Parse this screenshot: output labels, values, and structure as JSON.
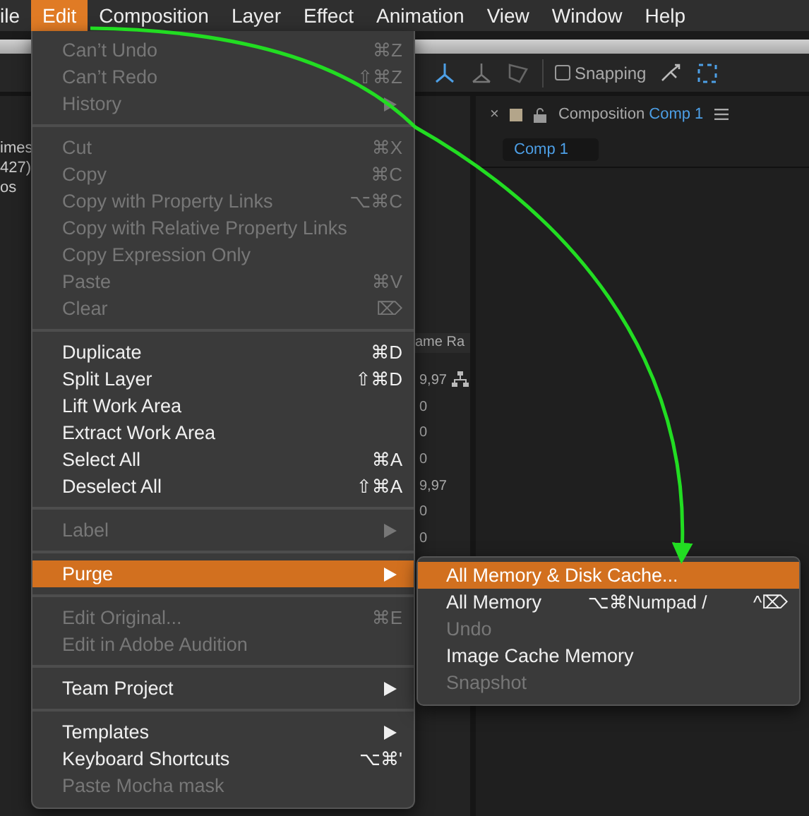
{
  "menubar": [
    {
      "label": "ile",
      "selected": false
    },
    {
      "label": "Edit",
      "selected": true
    },
    {
      "label": "Composition",
      "selected": false
    },
    {
      "label": "Layer",
      "selected": false
    },
    {
      "label": "Effect",
      "selected": false
    },
    {
      "label": "Animation",
      "selected": false
    },
    {
      "label": "View",
      "selected": false
    },
    {
      "label": "Window",
      "selected": false
    },
    {
      "label": "Help",
      "selected": false
    }
  ],
  "toolbar": {
    "snapping": {
      "label": "Snapping",
      "checked": false
    }
  },
  "left_panel": {
    "fragments": [
      "imes",
      "427)",
      "os"
    ],
    "column_header": "ame Ra",
    "cells": [
      "9,97",
      "0",
      "0",
      "0",
      "9,97",
      "0",
      "0"
    ]
  },
  "composition_panel": {
    "close": "×",
    "title": "Composition",
    "comp_name": "Comp 1",
    "tab": "Comp 1"
  },
  "edit_menu": [
    {
      "kind": "item",
      "label": "Can’t Undo",
      "shortcut": "⌘Z",
      "disabled": true,
      "submenu": false,
      "selected": false
    },
    {
      "kind": "item",
      "label": "Can’t Redo",
      "shortcut": "⇧⌘Z",
      "disabled": true,
      "submenu": false,
      "selected": false
    },
    {
      "kind": "item",
      "label": "History",
      "disabled": true,
      "submenu": true,
      "selected": false
    },
    {
      "kind": "separator"
    },
    {
      "kind": "item",
      "label": "Cut",
      "shortcut": "⌘X",
      "disabled": true,
      "submenu": false,
      "selected": false
    },
    {
      "kind": "item",
      "label": "Copy",
      "shortcut": "⌘C",
      "disabled": true,
      "submenu": false,
      "selected": false
    },
    {
      "kind": "item",
      "label": "Copy with Property Links",
      "shortcut": "⌥⌘C",
      "disabled": true,
      "submenu": false,
      "selected": false
    },
    {
      "kind": "item",
      "label": "Copy with Relative Property Links",
      "disabled": true,
      "submenu": false,
      "selected": false
    },
    {
      "kind": "item",
      "label": "Copy Expression Only",
      "disabled": true,
      "submenu": false,
      "selected": false
    },
    {
      "kind": "item",
      "label": "Paste",
      "shortcut": "⌘V",
      "disabled": true,
      "submenu": false,
      "selected": false
    },
    {
      "kind": "item",
      "label": "Clear",
      "shortcut": "⌦",
      "disabled": true,
      "submenu": false,
      "selected": false
    },
    {
      "kind": "separator"
    },
    {
      "kind": "item",
      "label": "Duplicate",
      "shortcut": "⌘D",
      "disabled": false,
      "submenu": false,
      "selected": false
    },
    {
      "kind": "item",
      "label": "Split Layer",
      "shortcut": "⇧⌘D",
      "disabled": false,
      "submenu": false,
      "selected": false
    },
    {
      "kind": "item",
      "label": "Lift Work Area",
      "disabled": false,
      "submenu": false,
      "selected": false
    },
    {
      "kind": "item",
      "label": "Extract Work Area",
      "disabled": false,
      "submenu": false,
      "selected": false
    },
    {
      "kind": "item",
      "label": "Select All",
      "shortcut": "⌘A",
      "disabled": false,
      "submenu": false,
      "selected": false
    },
    {
      "kind": "item",
      "label": "Deselect All",
      "shortcut": "⇧⌘A",
      "disabled": false,
      "submenu": false,
      "selected": false
    },
    {
      "kind": "separator"
    },
    {
      "kind": "item",
      "label": "Label",
      "disabled": true,
      "submenu": true,
      "selected": false
    },
    {
      "kind": "separator"
    },
    {
      "kind": "item",
      "label": "Purge",
      "disabled": false,
      "submenu": true,
      "selected": true
    },
    {
      "kind": "separator"
    },
    {
      "kind": "item",
      "label": "Edit Original...",
      "shortcut": "⌘E",
      "disabled": true,
      "submenu": false,
      "selected": false
    },
    {
      "kind": "item",
      "label": "Edit in Adobe Audition",
      "disabled": true,
      "submenu": false,
      "selected": false
    },
    {
      "kind": "separator"
    },
    {
      "kind": "item",
      "label": "Team Project",
      "disabled": false,
      "submenu": true,
      "selected": false
    },
    {
      "kind": "separator"
    },
    {
      "kind": "item",
      "label": "Templates",
      "disabled": false,
      "submenu": true,
      "selected": false
    },
    {
      "kind": "item",
      "label": "Keyboard Shortcuts",
      "shortcut": "⌥⌘'",
      "disabled": false,
      "submenu": false,
      "selected": false
    },
    {
      "kind": "item",
      "label": "Paste Mocha mask",
      "disabled": true,
      "submenu": false,
      "selected": false
    }
  ],
  "purge_submenu": [
    {
      "label": "All Memory & Disk Cache...",
      "disabled": false,
      "selected": true
    },
    {
      "label": "All Memory",
      "shortcut": "⌥⌘Numpad /",
      "shortcut_2": "^⌦",
      "disabled": false,
      "selected": false
    },
    {
      "label": "Undo",
      "disabled": true,
      "selected": false
    },
    {
      "label": "Image Cache Memory",
      "disabled": false,
      "selected": false
    },
    {
      "label": "Snapshot",
      "disabled": true,
      "selected": false
    }
  ]
}
